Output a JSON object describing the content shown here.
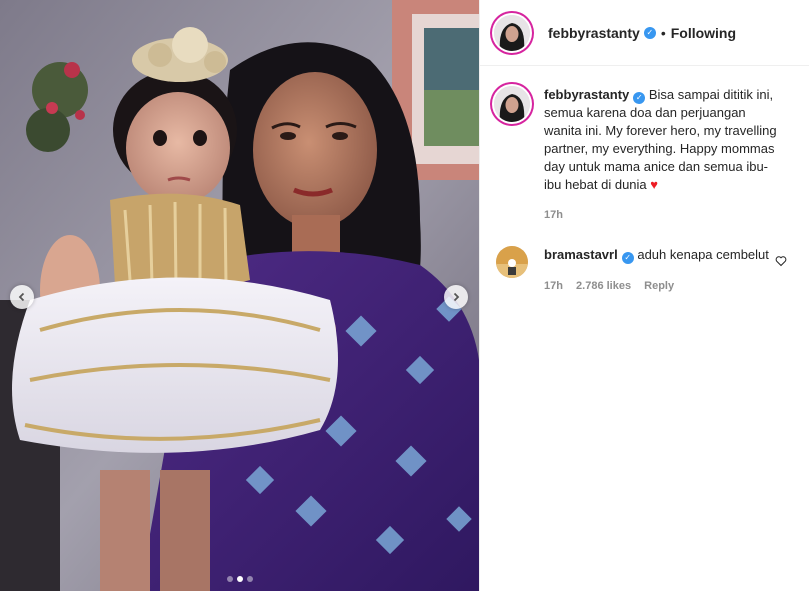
{
  "post": {
    "username": "febbyrastanty",
    "verified": true,
    "follow_status": "Following",
    "separator": "•",
    "caption": "Bisa sampai dititik ini, semua karena doa dan perjuangan wanita ini. My forever hero, my travelling partner, my everything. Happy mommas day untuk mama anice dan semua ibu-ibu hebat di dunia",
    "caption_emoji": "♥",
    "time": "17h"
  },
  "comment": {
    "username": "bramastavrl",
    "verified": true,
    "text": "aduh kenapa cembelut",
    "time": "17h",
    "likes": "2.786 likes",
    "reply_label": "Reply"
  },
  "carousel": {
    "slide_count": 3,
    "active_slide": 2
  },
  "colors": {
    "verified_blue": "#3897f0",
    "story_ring": "#d6249f",
    "meta_gray": "#8e8e8e"
  },
  "icons": {
    "prev": "chevron-left-icon",
    "next": "chevron-right-icon",
    "like": "heart-outline-icon",
    "verified": "verified-badge-icon"
  }
}
